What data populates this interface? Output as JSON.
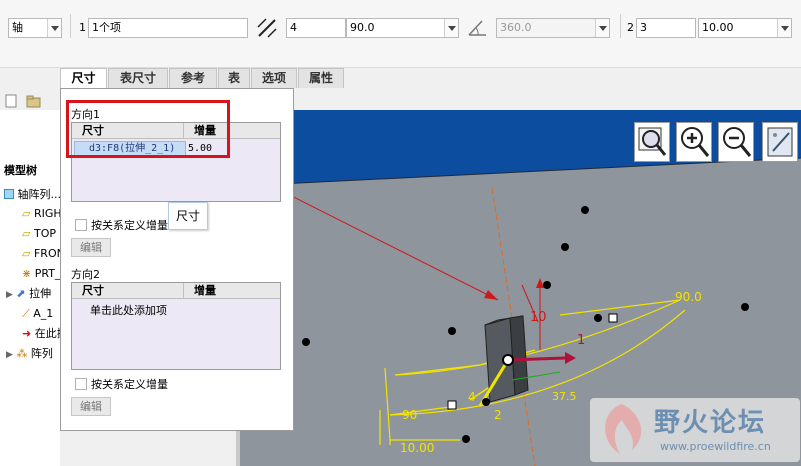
{
  "toolbar": {
    "type_value": "轴",
    "dir1_index": "1",
    "dir1_refs": "1个项",
    "dir1_count": "4",
    "dir1_increment": "90.0",
    "angle_value": "360.0",
    "dir2_index": "2",
    "dir2_count": "3",
    "dir2_increment": "10.00"
  },
  "tabs": [
    "尺寸",
    "表尺寸",
    "参考",
    "表",
    "选项",
    "属性"
  ],
  "panel": {
    "direction1": {
      "title": "方向1",
      "col_dimension": "尺寸",
      "col_increment": "增量",
      "row_dim": "d3:F8(拉伸_2_1)",
      "row_inc": "5.00",
      "checkbox_label": "按关系定义增量",
      "edit_button": "编辑",
      "tooltip": "尺寸"
    },
    "direction2": {
      "title": "方向2",
      "col_dimension": "尺寸",
      "col_increment": "增量",
      "add_item": "单击此处添加项",
      "checkbox_label": "按关系定义增量",
      "edit_button": "编辑"
    }
  },
  "model_tree": {
    "title": "模型树",
    "items": [
      "轴阵列...",
      "RIGHT",
      "TOP",
      "FRONT",
      "PRT_CSYS_DEF",
      "拉伸",
      "A_1",
      "在此插入",
      "阵列"
    ]
  },
  "viewport_labels": {
    "dim_10": "10",
    "dim_1": "1",
    "dim_90": "90.0",
    "dim_4": "4",
    "dim_2": "2",
    "dim_90b": "90",
    "dim_100": "10.00",
    "dim_375": "37.5"
  },
  "watermark": {
    "cn": "野火论坛",
    "url": "www.proewildfire.cn"
  },
  "colors": {
    "highlight_red": "#d8141a",
    "viewport_top": "#0d4da0",
    "viewport_bottom": "#8f959c",
    "selection_yellow": "#f2e300"
  }
}
